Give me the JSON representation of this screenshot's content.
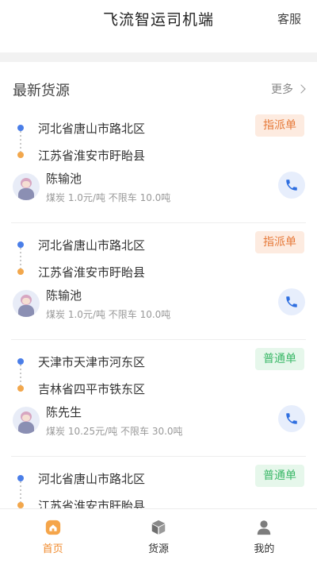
{
  "header": {
    "title": "飞流智运司机端",
    "service_label": "客服"
  },
  "section": {
    "title": "最新货源",
    "more_label": "更多"
  },
  "colors": {
    "accent_orange": "#f08a2c",
    "origin_dot": "#4a7ee8",
    "destination_dot": "#f2a74c",
    "tag_assign_text": "#e67a3a",
    "tag_normal_text": "#3bb868"
  },
  "cargo_list": [
    {
      "origin": "河北省唐山市路北区",
      "destination": "江苏省淮安市盱眙县",
      "tag": "指派单",
      "name": "陈输池",
      "detail": "煤炭 1.0元/吨 不限车 10.0吨"
    },
    {
      "origin": "河北省唐山市路北区",
      "destination": "江苏省淮安市盱眙县",
      "tag": "指派单",
      "name": "陈输池",
      "detail": "煤炭 1.0元/吨 不限车 10.0吨"
    },
    {
      "origin": "天津市天津市河东区",
      "destination": "吉林省四平市铁东区",
      "tag": "普通单",
      "name": "陈先生",
      "detail": "煤炭 10.25元/吨 不限车 30.0吨"
    },
    {
      "origin": "河北省唐山市路北区",
      "destination": "江苏省淮安市盱眙县",
      "tag": "普通单",
      "name": "",
      "detail": ""
    }
  ],
  "tabbar": {
    "tabs": [
      {
        "label": "首页",
        "icon": "home-icon",
        "active": true
      },
      {
        "label": "货源",
        "icon": "package-icon",
        "active": false
      },
      {
        "label": "我的",
        "icon": "user-icon",
        "active": false
      }
    ]
  }
}
